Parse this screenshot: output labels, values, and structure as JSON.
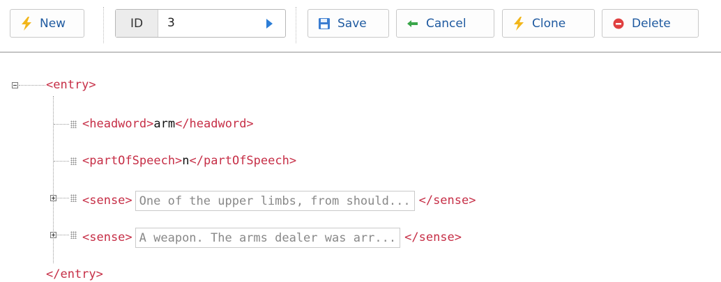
{
  "toolbar": {
    "new_label": "New",
    "id_label": "ID",
    "id_value": "3",
    "save_label": "Save",
    "cancel_label": "Cancel",
    "clone_label": "Clone",
    "delete_label": "Delete"
  },
  "xml": {
    "root_open": "<entry>",
    "root_close": "</entry>",
    "headword_open": "<headword>",
    "headword_value": "arm",
    "headword_close": "</headword>",
    "pos_open": "<partOfSpeech>",
    "pos_value": "n",
    "pos_close": "</partOfSpeech>",
    "senses": [
      {
        "open": "<sense>",
        "preview": "One of the upper limbs, from should...",
        "close": "</sense>"
      },
      {
        "open": "<sense>",
        "preview": "A weapon. The arms dealer was arr...",
        "close": "</sense>"
      }
    ]
  },
  "colors": {
    "tag": "#c62e46",
    "button_text": "#1f5aa0",
    "accent_blue": "#2c7dd6",
    "delete_red": "#e04040",
    "bolt_yellow": "#f2b61a",
    "cancel_green": "#3aa64a"
  },
  "icons": [
    "lightning-icon",
    "play-arrow-icon",
    "floppy-disk-icon",
    "arrow-left-icon",
    "lightning-icon",
    "delete-circle-icon"
  ]
}
